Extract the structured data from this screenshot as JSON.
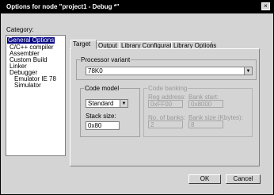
{
  "window": {
    "title": "Options for node \"project1 - Debug *\"",
    "close_glyph": "×"
  },
  "category": {
    "label": "Category:",
    "items": [
      {
        "label": "General Options",
        "selected": true
      },
      {
        "label": "C/C++ compiler"
      },
      {
        "label": "Assembler"
      },
      {
        "label": "Custom Build"
      },
      {
        "label": "Linker"
      },
      {
        "label": "Debugger"
      },
      {
        "label": "Emulator IE 78"
      },
      {
        "label": "Simulator"
      }
    ]
  },
  "tabs": [
    "Target",
    "Output",
    "Library Configuration",
    "Library Options"
  ],
  "processor": {
    "group_label": "Processor variant",
    "selected": "78K0"
  },
  "code_model": {
    "group_label": "Code model",
    "selected": "Standard",
    "stack_label": "Stack size:",
    "stack_value": "0x80"
  },
  "code_banking": {
    "group_label": "Code banking",
    "reg_address_label": "Reg address:",
    "reg_address_value": "0xFF00",
    "bank_start_label": "Bank start:",
    "bank_start_value": "0x8000",
    "num_banks_label": "No. of banks:",
    "num_banks_value": "2",
    "bank_size_label": "Bank size (Kbytes):",
    "bank_size_value": "8"
  },
  "buttons": {
    "ok": "OK",
    "cancel": "Cancel"
  },
  "icons": {
    "dropdown": "chevron-down-icon"
  }
}
